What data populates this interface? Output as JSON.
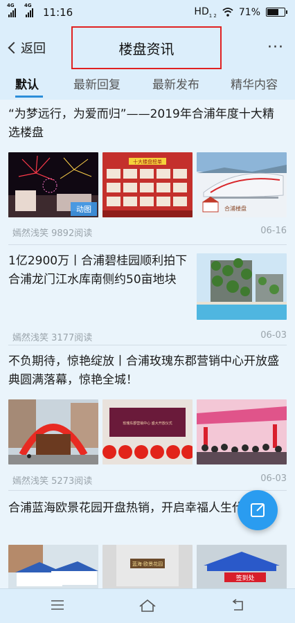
{
  "status": {
    "time": "11:16",
    "sim1": "4G",
    "sim2": "4G",
    "hd": "HD",
    "hd_sub": "1 2",
    "battery": "71%",
    "battery_level": 0.71
  },
  "nav": {
    "back_label": "返回",
    "title": "楼盘资讯",
    "more": "···"
  },
  "tabs": [
    "默认",
    "最新回复",
    "最新发布",
    "精华内容"
  ],
  "posts": [
    {
      "title": "“为梦远行，为爱而归”——2019年合浦年度十大精选楼盘",
      "meta": "嫣然浅笑 9892阅读",
      "date": "06-16",
      "badge": "动图"
    },
    {
      "title": "1亿2900万丨合浦碧桂园顺利拍下合浦龙门江水库南侧约50亩地块",
      "meta": "嫣然浅笑 3177阅读",
      "date": "06-03"
    },
    {
      "title": "不负期待，惊艳绽放丨合浦玫瑰东郡营销中心开放盛典圆满落幕，惊艳全城！",
      "meta": "嫣然浅笑 5273阅读",
      "date": "06-03"
    },
    {
      "title": "合浦蓝海欧景花园开盘热销，开启幸福人生代！"
    }
  ],
  "image_text": {
    "banner_yellow": "十大楼盘榜单",
    "train_logo": "合浦楼盘",
    "roses_banner": "玫瑰东郡营销中心 盛大开放仪式",
    "lanhai_sign": "蓝海·欧景花园",
    "checkin": "签到处"
  },
  "colors": {
    "header_bg": "#dceefb",
    "accent": "#2a8dd9",
    "fab": "#2a9cf0",
    "highlight_border": "#e02020"
  }
}
